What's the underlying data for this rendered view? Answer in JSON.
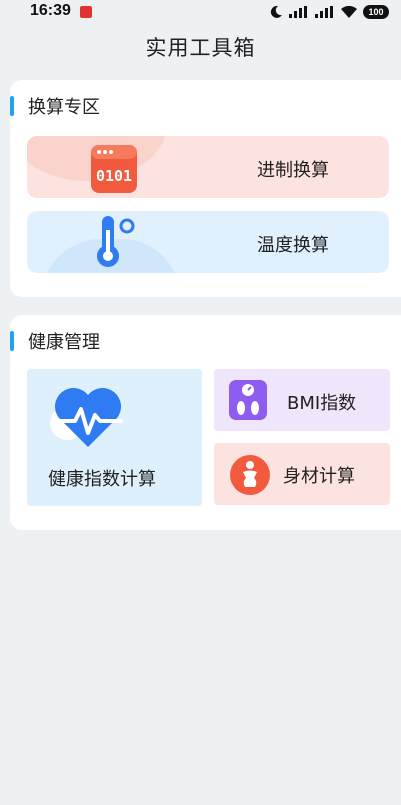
{
  "status_bar": {
    "time": "16:39",
    "battery": "100",
    "icons": [
      "moon-icon",
      "signal-icon",
      "signal-icon",
      "wifi-icon",
      "battery-icon"
    ]
  },
  "title": "实用工具箱",
  "sections": {
    "convert": {
      "title": "换算专区",
      "items": [
        {
          "label": "进制换算",
          "icon": "binary-calculator-icon"
        },
        {
          "label": "温度换算",
          "icon": "thermometer-icon"
        }
      ]
    },
    "health": {
      "title": "健康管理",
      "items": [
        {
          "label": "健康指数计算",
          "icon": "heart-pulse-icon"
        },
        {
          "label": "BMI指数",
          "icon": "scale-icon"
        },
        {
          "label": "身材计算",
          "icon": "body-figure-icon"
        }
      ]
    }
  },
  "colors": {
    "accent": "#1fa2f2",
    "background": "#eef1f4",
    "tile_red": "#fde3df",
    "tile_blue": "#e0f0fd",
    "tile_purple": "#efe6fb"
  }
}
